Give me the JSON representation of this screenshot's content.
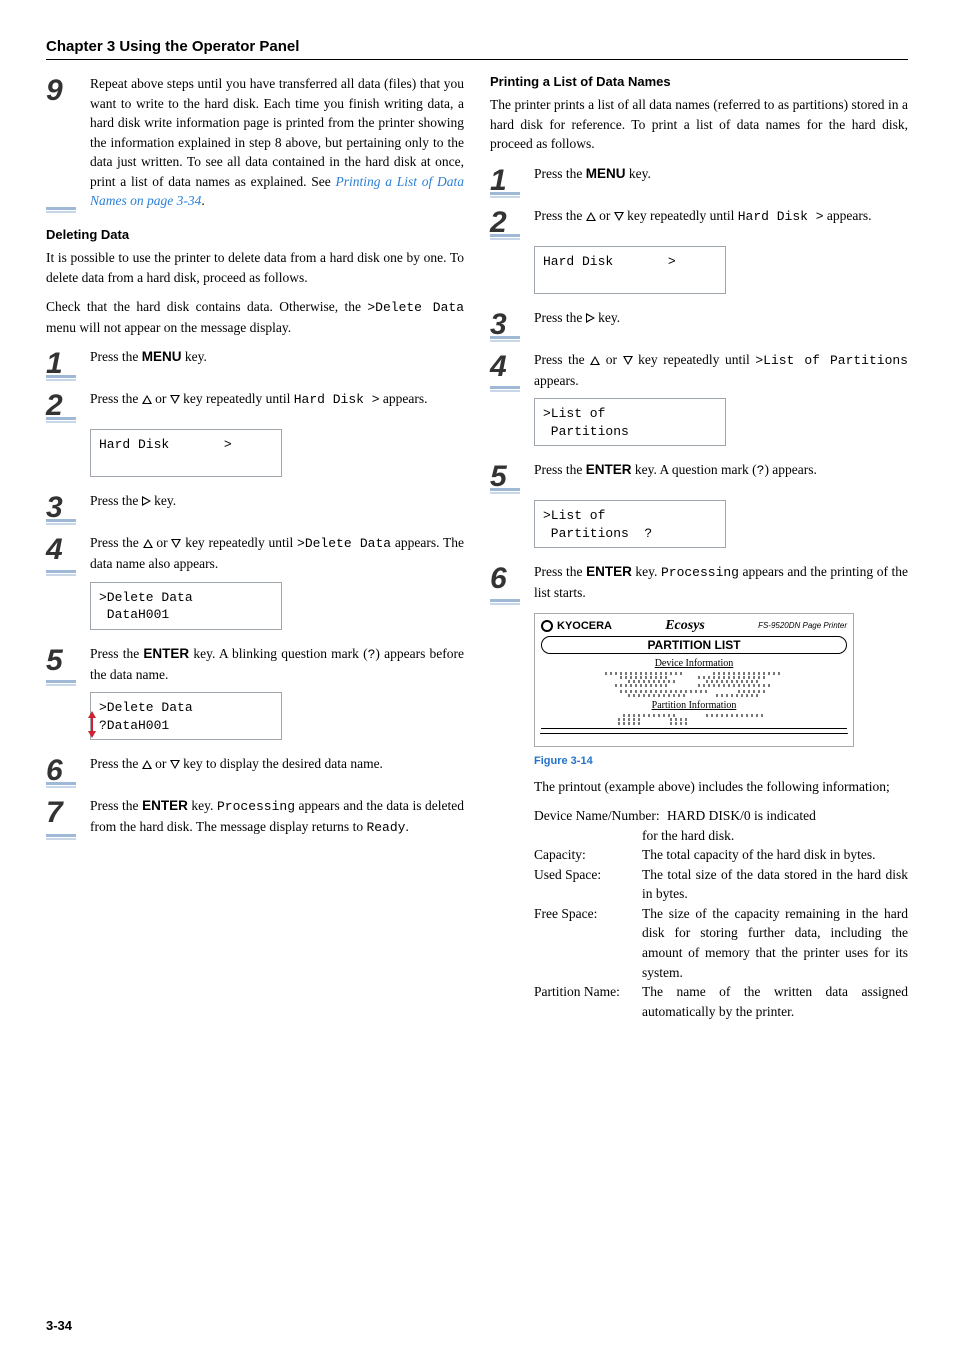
{
  "chapter_title": "Chapter 3  Using the Operator Panel",
  "page_number": "3-34",
  "left": {
    "step9": {
      "num": "9",
      "text": "Repeat above steps until you have transferred all data (files) that you want to write to the hard disk. Each time you finish writing data, a hard disk write information page is printed from the printer showing the information explained in step 8 above, but pertaining only to the data just written. To see all data contained in the hard disk at once, print a list of data names as explained. See ",
      "xref": "Printing a List of Data Names on page 3-34",
      "tail": "."
    },
    "del_heading": "Deleting Data",
    "del_p1": "It is possible to use the printer to delete data from a hard disk one by one. To delete data from a hard disk, proceed as follows.",
    "del_p2_a": "Check that the hard disk contains data. Otherwise, the ",
    "del_p2_code": ">Delete Data",
    "del_p2_b": " menu will not appear on the message display.",
    "s1": {
      "num": "1",
      "a": "Press the ",
      "key": "MENU",
      "b": " key."
    },
    "s2": {
      "num": "2",
      "a": "Press the ",
      "b": " or ",
      "c": " key repeatedly until ",
      "code": "Hard Disk >",
      "d": " appears."
    },
    "lcd1": "Hard Disk       >",
    "s3": {
      "num": "3",
      "a": "Press the ",
      "b": " key."
    },
    "s4": {
      "num": "4",
      "a": "Press the ",
      "b": " or ",
      "c": " key repeatedly until ",
      "code": ">Delete Data",
      "d": " appears. The data name also appears."
    },
    "lcd2_l1": ">Delete Data",
    "lcd2_l2": " DataH001",
    "s5": {
      "num": "5",
      "a": "Press the ",
      "key": "ENTER",
      "b": " key. A blinking question mark (",
      "q": "?",
      "c": ") appears before the data name."
    },
    "lcd3_l1": ">Delete Data",
    "lcd3_l2": "?DataH001",
    "s6": {
      "num": "6",
      "a": "Press the ",
      "b": " or ",
      "c": " key to display the desired data name."
    },
    "s7": {
      "num": "7",
      "a": "Press the ",
      "key": "ENTER",
      "b": " key. ",
      "code": "Processing",
      "c": " appears and the data is deleted from the hard disk. The message display returns to ",
      "code2": "Ready",
      "d": "."
    }
  },
  "right": {
    "heading": "Printing a List of Data Names",
    "intro": "The printer prints a list of all data names (referred to as partitions) stored in a hard disk for reference. To print a list of data names for the hard disk, proceed as follows.",
    "s1": {
      "num": "1",
      "a": "Press the ",
      "key": "MENU",
      "b": " key."
    },
    "s2": {
      "num": "2",
      "a": "Press the ",
      "b": " or ",
      "c": " key repeatedly until ",
      "code": "Hard Disk >",
      "d": " appears."
    },
    "lcd1": "Hard Disk       >",
    "s3": {
      "num": "3",
      "a": "Press the ",
      "b": " key."
    },
    "s4": {
      "num": "4",
      "a": "Press the ",
      "b": " or ",
      "c": " key repeatedly until ",
      "code": ">List  of Partitions",
      "d": " appears."
    },
    "lcd2_l1": ">List of",
    "lcd2_l2": " Partitions",
    "s5": {
      "num": "5",
      "a": "Press the ",
      "key": "ENTER",
      "b": " key. A question mark (",
      "q": "?",
      "c": ") appears."
    },
    "lcd3_l1": ">List of",
    "lcd3_l2": " Partitions  ?",
    "s6": {
      "num": "6",
      "a": "Press the ",
      "key": "ENTER",
      "b": " key. ",
      "code": "Processing",
      "c": " appears and the printing of the list starts."
    },
    "fig": {
      "brand": "KYOCERA",
      "ecosys": "Ecosys",
      "model": "FS-9520DN  Page Printer",
      "title": "PARTITION LIST",
      "sub1": "Device Information",
      "sub2": "Partition Information",
      "caption": "Figure 3-14"
    },
    "printout_intro": "The printout (example above) includes the following information;",
    "info": [
      {
        "k": "Device Name/Number:",
        "v": "HARD DISK/0 is indicated for the hard disk.",
        "wide": true
      },
      {
        "k": "Capacity:",
        "v": "The total capacity of the hard disk in bytes."
      },
      {
        "k": "Used Space:",
        "v": "The total size of the data stored in the hard disk in bytes."
      },
      {
        "k": "Free Space:",
        "v": "The size of the capacity remaining in the hard disk for storing further data, including the amount of memory that the printer uses for its system."
      },
      {
        "k": "Partition Name:",
        "v": "The name of the written data assigned automatically by the printer."
      }
    ]
  }
}
